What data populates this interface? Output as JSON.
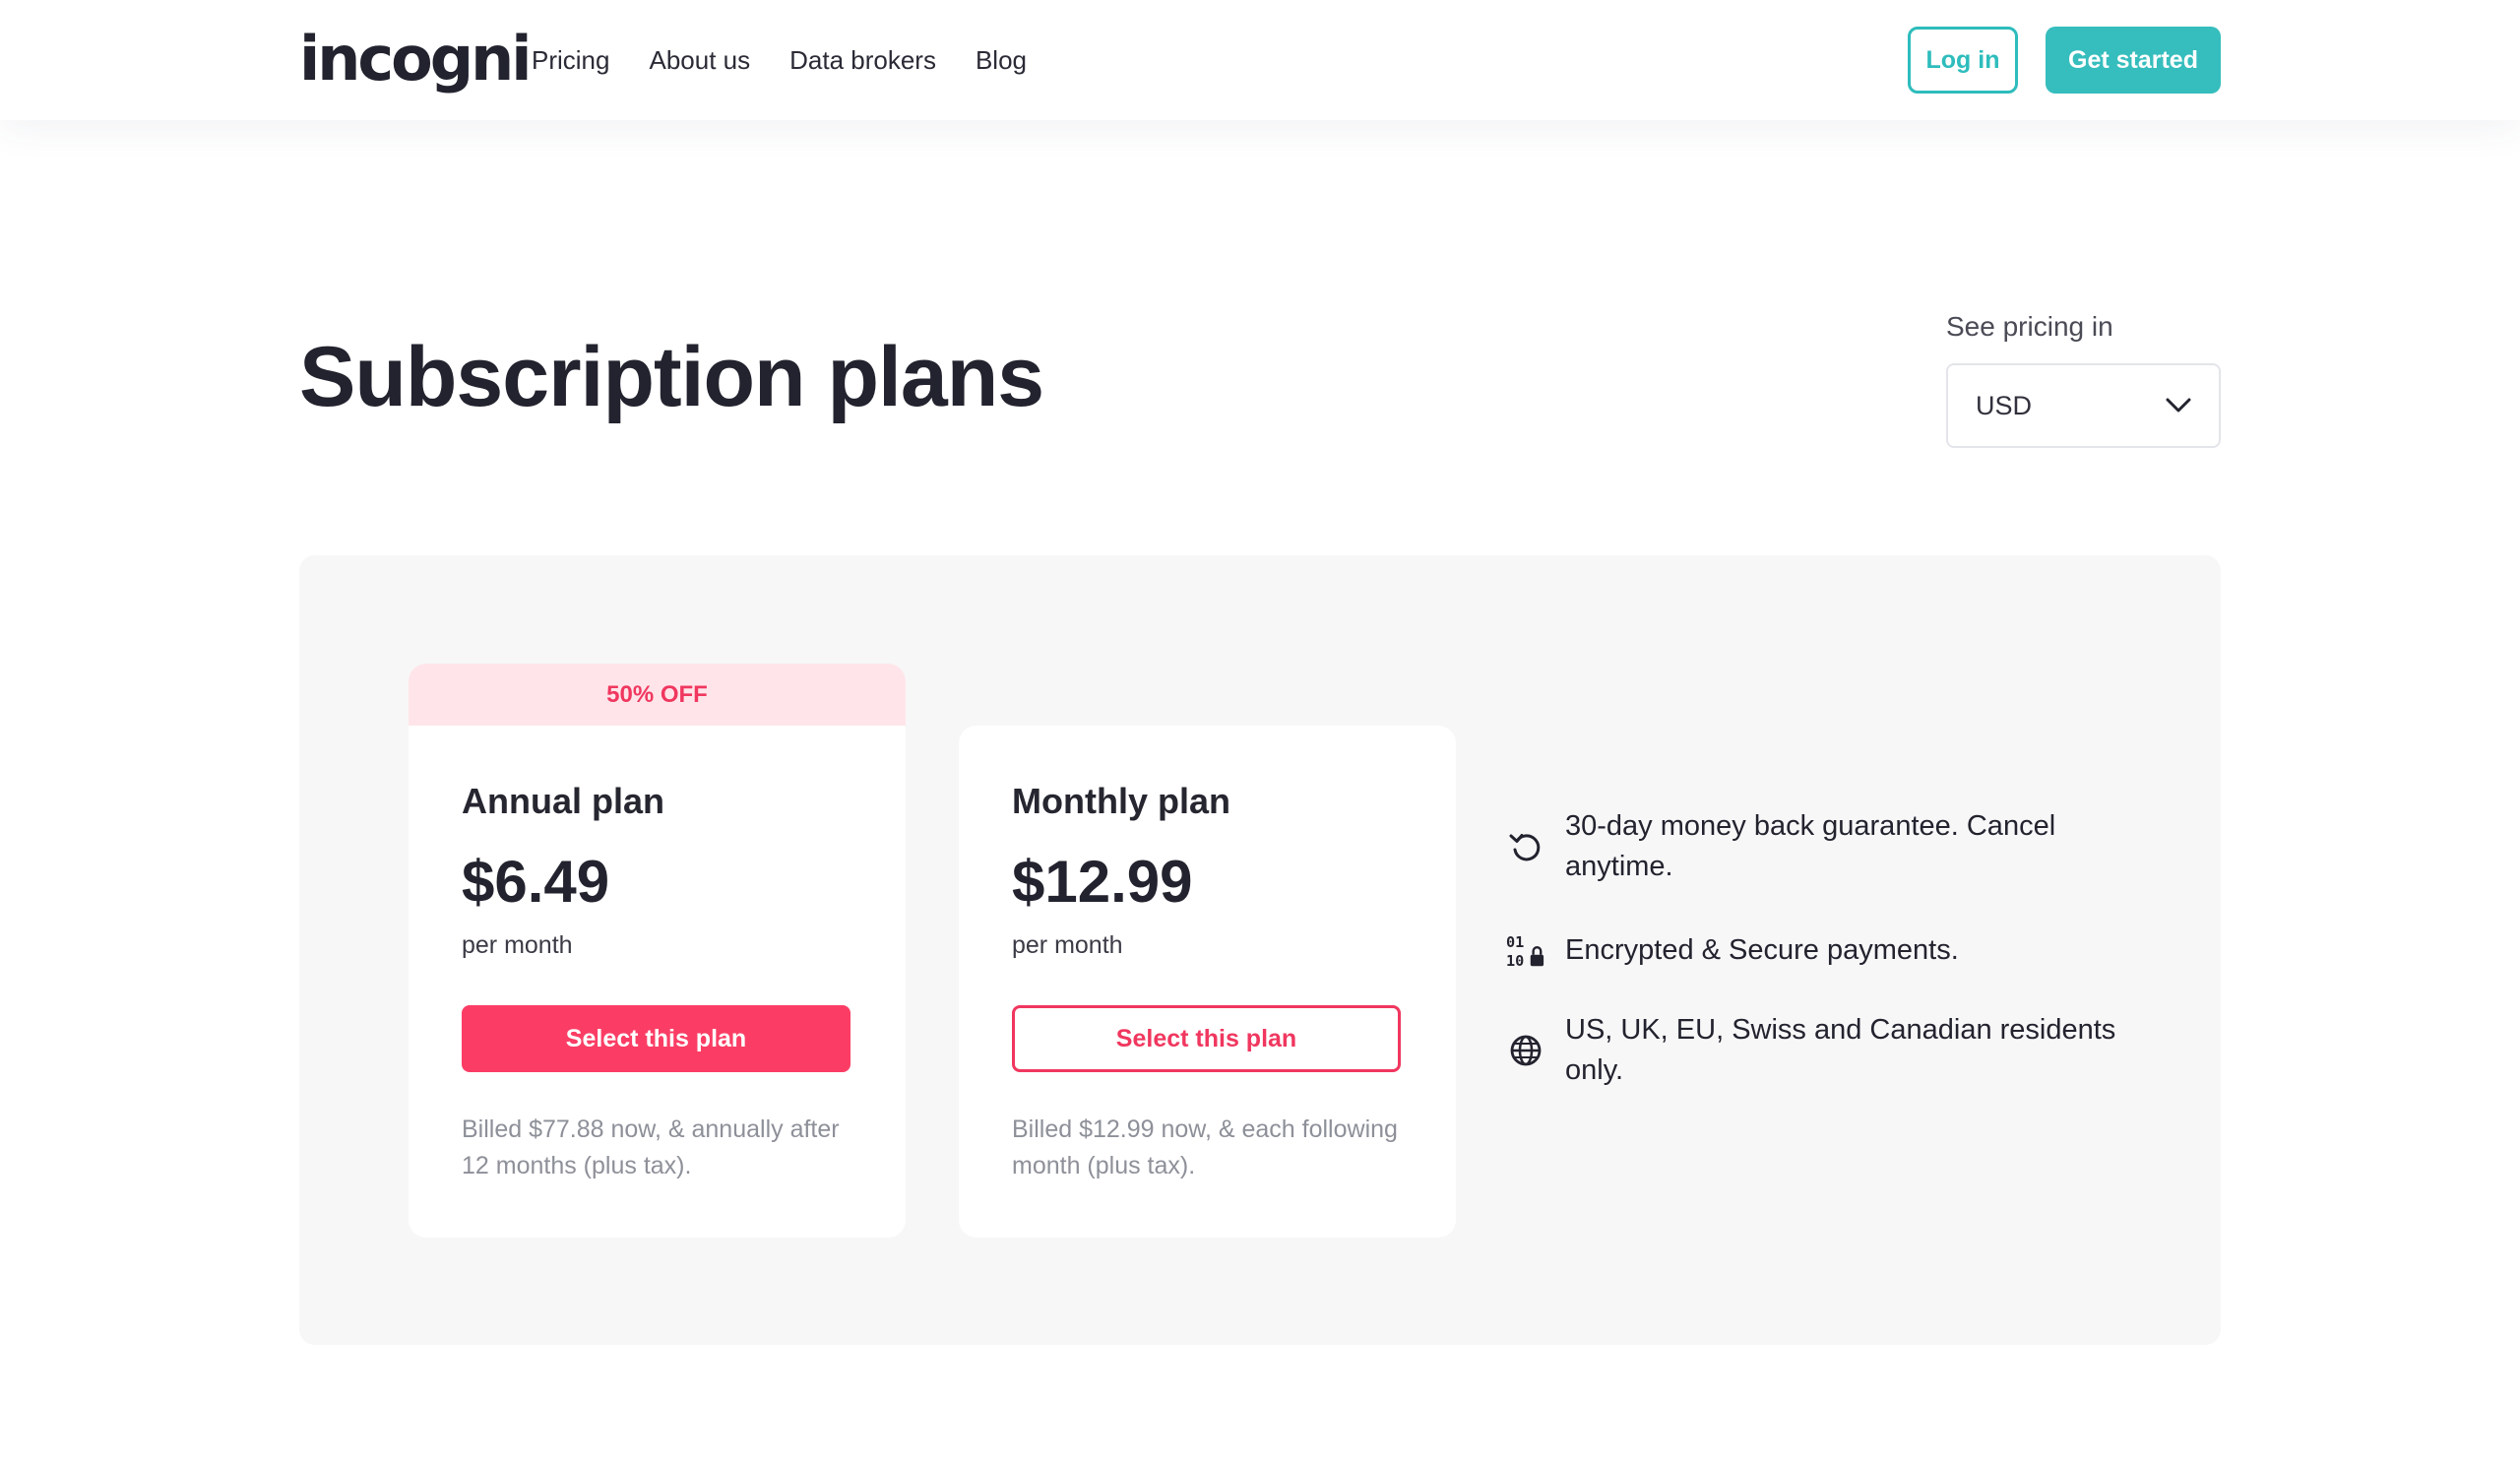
{
  "header": {
    "logo": "incogni",
    "nav": [
      {
        "label": "Pricing"
      },
      {
        "label": "About us"
      },
      {
        "label": "Data brokers"
      },
      {
        "label": "Blog"
      }
    ],
    "login_label": "Log in",
    "get_started_label": "Get started"
  },
  "main": {
    "title": "Subscription plans",
    "pricing_label": "See pricing in",
    "currency": "USD",
    "plans": [
      {
        "badge": "50% OFF",
        "name": "Annual plan",
        "price": "$6.49",
        "period": "per month",
        "button": "Select this plan",
        "note": "Billed $77.88 now, & annually after 12 months (plus tax)."
      },
      {
        "name": "Monthly plan",
        "price": "$12.99",
        "period": "per month",
        "button": "Select this plan",
        "note": "Billed $12.99 now, & each following month (plus tax)."
      }
    ],
    "features": [
      {
        "icon": "refresh-icon",
        "text": "30-day money back guarantee. Cancel anytime."
      },
      {
        "icon": "encrypted-lock-icon",
        "text": "Encrypted & Secure payments."
      },
      {
        "icon": "globe-icon",
        "text": "US, UK, EU, Swiss and Canadian residents only."
      }
    ]
  },
  "colors": {
    "teal": "#36bdbd",
    "pink": "#fb3d65",
    "badge_bg": "#ffe5ea",
    "panel_bg": "#f7f7f8"
  }
}
